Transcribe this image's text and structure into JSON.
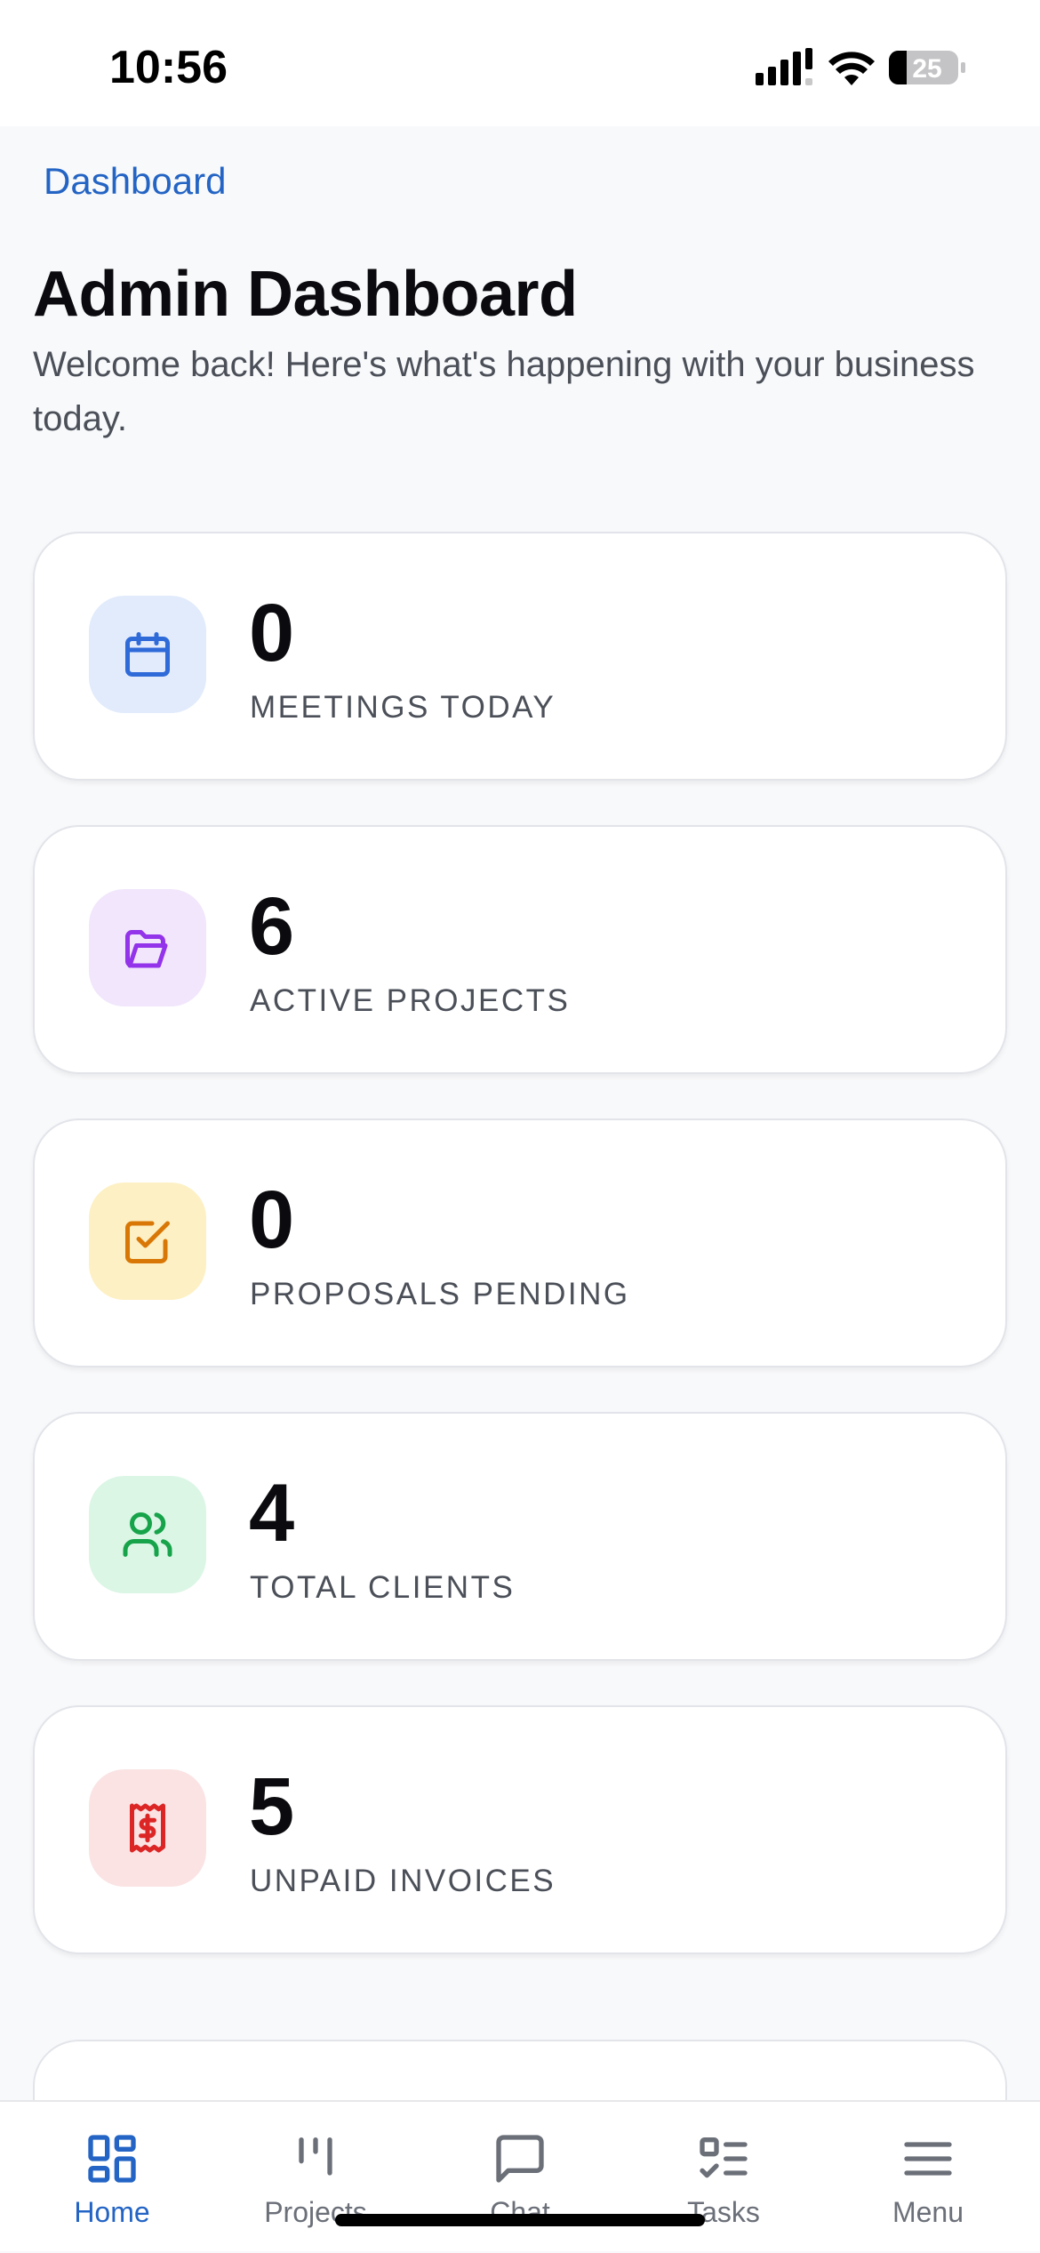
{
  "status_bar": {
    "time": "10:56",
    "battery": "25"
  },
  "breadcrumb": "Dashboard",
  "header": {
    "title": "Admin Dashboard",
    "subtitle": "Welcome back! Here's what's happening with your business today."
  },
  "stats": [
    {
      "value": "0",
      "label": "MEETINGS TODAY",
      "icon": "calendar-icon",
      "bg": "#e1ebfb",
      "color": "#2f6ad9"
    },
    {
      "value": "6",
      "label": "ACTIVE PROJECTS",
      "icon": "folder-open-icon",
      "bg": "#f1e6fb",
      "color": "#9333ea"
    },
    {
      "value": "0",
      "label": "PROPOSALS PENDING",
      "icon": "checkbox-icon",
      "bg": "#fdf0c4",
      "color": "#d97706"
    },
    {
      "value": "4",
      "label": "TOTAL CLIENTS",
      "icon": "users-icon",
      "bg": "#dbf6e5",
      "color": "#16a34a"
    },
    {
      "value": "5",
      "label": "UNPAID INVOICES",
      "icon": "invoice-icon",
      "bg": "#fbe3e4",
      "color": "#dc2626"
    }
  ],
  "tabs": [
    {
      "label": "Home",
      "icon": "home-grid-icon",
      "active": true
    },
    {
      "label": "Projects",
      "icon": "kanban-icon",
      "active": false
    },
    {
      "label": "Chat",
      "icon": "chat-icon",
      "active": false
    },
    {
      "label": "Tasks",
      "icon": "tasks-icon",
      "active": false
    },
    {
      "label": "Menu",
      "icon": "menu-icon",
      "active": false
    }
  ],
  "colors": {
    "accent": "#2364c4",
    "background": "#f8f9fb"
  }
}
